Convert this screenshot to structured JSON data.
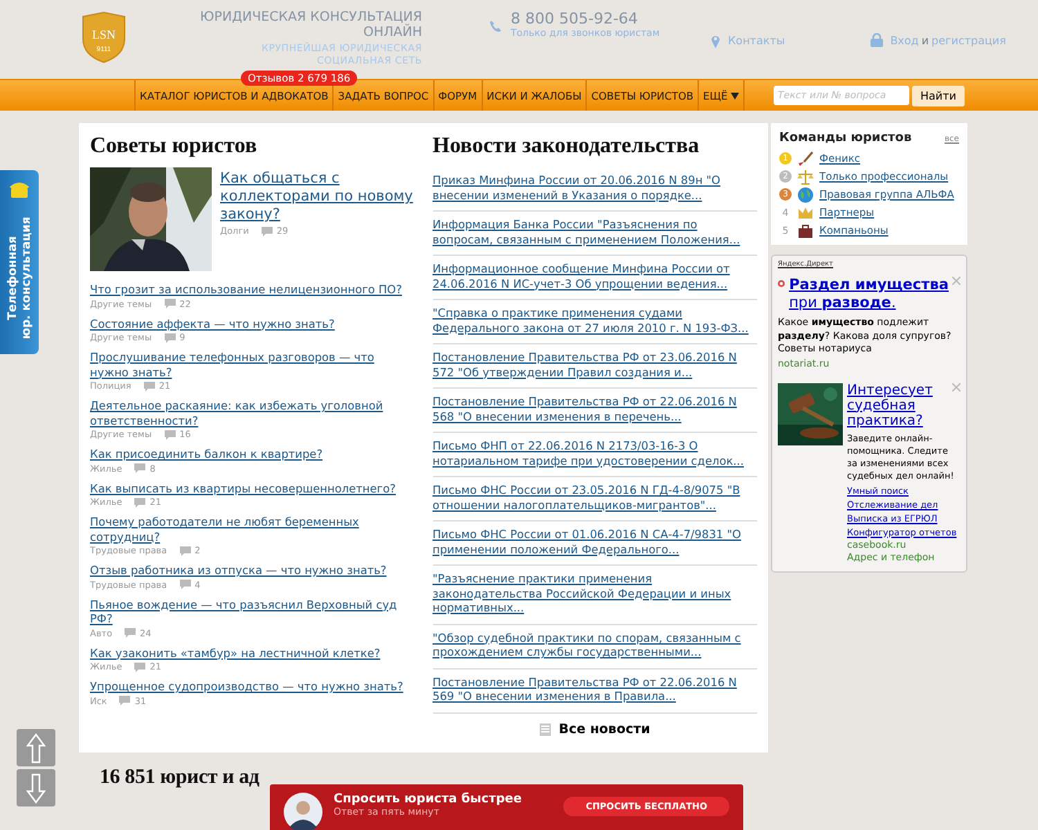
{
  "header": {
    "logo": {
      "letters": "LSN",
      "number": "9111"
    },
    "title": "ЮРИДИЧЕСКАЯ КОНСУЛЬТАЦИЯ ОНЛАЙН",
    "subtitle": "КРУПНЕЙШАЯ ЮРИДИЧЕСКАЯ СОЦИАЛЬНАЯ СЕТЬ",
    "phone": "8 800 505-92-64",
    "phone_note": "Только для звонков юристам",
    "contacts": "Контакты",
    "login": "Вход",
    "login_joiner": "и",
    "register": "регистрация"
  },
  "nav": {
    "badge": "Отзывов 2 679 186",
    "items": [
      {
        "label": "КАТАЛОГ ЮРИСТОВ И АДВОКАТОВ",
        "dropdown": false
      },
      {
        "label": "ЗАДАТЬ ВОПРОС",
        "dropdown": false
      },
      {
        "label": "ФОРУМ",
        "dropdown": false
      },
      {
        "label": "ИСКИ И ЖАЛОБЫ",
        "dropdown": false
      },
      {
        "label": "СОВЕТЫ ЮРИСТОВ",
        "dropdown": false
      },
      {
        "label": "ЕЩЁ",
        "dropdown": true
      }
    ],
    "search": {
      "placeholder": "Текст или № вопроса"
    },
    "search_button": "Найти"
  },
  "side_tab": {
    "line1": "Телефонная",
    "line2": "юр. консультация"
  },
  "advice": {
    "title": "Советы юристов",
    "featured": {
      "title": "Как общаться с коллекторами по новому закону?",
      "category": "Долги",
      "comments": "29"
    },
    "articles": [
      {
        "title": "Что грозит за использование нелицензионного ПО?",
        "category": "Другие темы",
        "comments": "22"
      },
      {
        "title": "Состояние аффекта — что нужно знать?",
        "category": "Другие темы",
        "comments": "9"
      },
      {
        "title": "Прослушивание телефонных разговоров — что нужно знать?",
        "category": "Полиция",
        "comments": "21"
      },
      {
        "title": "Деятельное раскаяние: как избежать уголовной ответственности?",
        "category": "Другие темы",
        "comments": "16"
      },
      {
        "title": "Как присоединить балкон к квартире?",
        "category": "Жилье",
        "comments": "8"
      },
      {
        "title": "Как выписать из квартиры несовершеннолетнего?",
        "category": "Жилье",
        "comments": "21"
      },
      {
        "title": "Почему работодатели не любят беременных сотрудниц?",
        "category": "Трудовые права",
        "comments": "2"
      },
      {
        "title": "Отзыв работника из отпуска — что нужно знать?",
        "category": "Трудовые права",
        "comments": "4"
      },
      {
        "title": "Пьяное вождение — что разъяснил Верховный суд РФ?",
        "category": "Авто",
        "comments": "24"
      },
      {
        "title": "Как узаконить «тамбур» на лестничной клетке?",
        "category": "Жилье",
        "comments": "21"
      },
      {
        "title": "Упрощенное судопроизводство — что нужно знать?",
        "category": "Иск",
        "comments": "31"
      }
    ]
  },
  "news": {
    "title": "Новости законодательства",
    "items": [
      "Приказ Минфина России от 20.06.2016 N 89н \"О внесении изменений в Указания о порядке...",
      "Информация Банка России \"Разъяснения по вопросам, связанным с применением Положения...",
      "Информационное сообщение Минфина России от 24.06.2016 N ИС-учет-3 Об упрощении ведения...",
      "\"Справка о практике применения судами Федерального закона от 27 июля 2010 г. N 193-ФЗ...",
      "Постановление Правительства РФ от 23.06.2016 N 572 \"Об утверждении Правил создания и...",
      "Постановление Правительства РФ от 22.06.2016 N 568 \"О внесении изменения в перечень...",
      "Письмо ФНП от 22.06.2016 N 2173/03-16-3 О нотариальном тарифе при удостоверении сделок...",
      "Письмо ФНС России от 23.05.2016 N ГД-4-8/9075 \"В отношении налогоплательщиков-мигрантов\"...",
      "Письмо ФНС России от 01.06.2016 N СА-4-7/9831 \"О применении положений Федерального...",
      "\"Разъяснение практики применения законодательства Российской Федерации и иных нормативных...",
      "\"Обзор судебной практики по спорам, связанным с прохождением службы государственными...",
      "Постановление Правительства РФ от 22.06.2016 N 569 \"О внесении изменения в Правила..."
    ],
    "all_link": "Все новости"
  },
  "teams": {
    "title": "Команды юристов",
    "all_link": "все",
    "items": [
      {
        "rank": "1",
        "color": "#f2c81f",
        "name": "Феникс"
      },
      {
        "rank": "2",
        "color": "#bdbdbd",
        "name": "Только профессионалы"
      },
      {
        "rank": "3",
        "color": "#d9853b",
        "name": "Правовая группа АЛЬФА"
      },
      {
        "rank": "4",
        "name": "Партнеры"
      },
      {
        "rank": "5",
        "name": "Компаньоны"
      }
    ]
  },
  "ads": {
    "label": "Яндекс.Директ",
    "ad1": {
      "title": "**Раздел имущества** при **разводе**.",
      "text": "Какое **имущество** подлежит **разделу**? Какова доля супругов? Советы нотариуса",
      "domain": "notariat.ru"
    },
    "ad2": {
      "title": "Интересует судебная практика?",
      "text": "Заведите онлайн-помощника. Следите за изменениями всех судебных дел онлайн!",
      "links": [
        "Умный поиск",
        "Отслеживание дел",
        "Выписка из ЕГРЮЛ",
        "Конфигуратор отчетов"
      ],
      "domain": "casebook.ru",
      "contact": "Адрес и телефон"
    }
  },
  "lawyers_heading": "16 851 юрист и ад",
  "popup": {
    "title": "Спросить юриста быстрее",
    "subtitle": "Ответ за пять минут",
    "button": "СПРОСИТЬ БЕСПЛАТНО"
  }
}
